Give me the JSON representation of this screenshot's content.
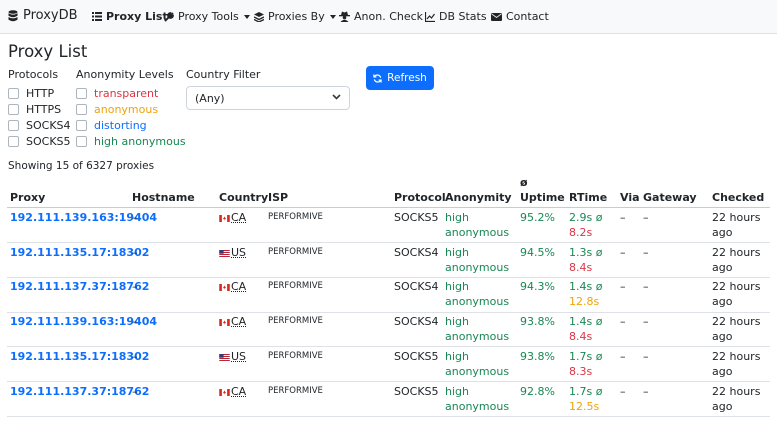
{
  "navbar": {
    "brand": "ProxyDB",
    "items": [
      {
        "label": "Proxy List",
        "icon": "list-icon",
        "bold": true
      },
      {
        "label": "Proxy Tools",
        "icon": "wrench-icon",
        "dropdown": true
      },
      {
        "label": "Proxies By",
        "icon": "layers-icon",
        "dropdown": true
      },
      {
        "label": "Anon. Check",
        "icon": "spy-icon"
      },
      {
        "label": "DB Stats",
        "icon": "chart-icon"
      },
      {
        "label": "Contact",
        "icon": "envelope-icon"
      }
    ]
  },
  "page": {
    "title": "Proxy List",
    "showing": "Showing 15 of 6327 proxies"
  },
  "filters": {
    "protocols_title": "Protocols",
    "protocols": [
      "HTTP",
      "HTTPS",
      "SOCKS4",
      "SOCKS5"
    ],
    "anonymity_title": "Anonymity Levels",
    "anonymity": [
      {
        "label": "transparent",
        "color": "#dc3545"
      },
      {
        "label": "anonymous",
        "color": "#f0a30a"
      },
      {
        "label": "distorting",
        "color": "#0d6efd"
      },
      {
        "label": "high anonymous",
        "color": "#198754"
      }
    ],
    "country_title": "Country Filter",
    "country_value": "(Any)",
    "refresh_label": "Refresh"
  },
  "table": {
    "headers": {
      "proxy": "Proxy",
      "hostname": "Hostname",
      "country": "Country",
      "isp": "ISP",
      "protocol": "Protocol",
      "anonymity": "Anonymity",
      "uptime_symbol": "ø",
      "uptime": "Uptime",
      "rtime": "RTime",
      "via": "Via",
      "gateway": "Gateway",
      "checked": "Checked"
    },
    "rows": [
      {
        "proxy": "192.111.139.163:19404",
        "hostname": "–",
        "country": "CA",
        "isp": "PERFORMIVE",
        "protocol": "SOCKS5",
        "anon1": "high",
        "anon2": "anonymous",
        "uptime": "95.2%",
        "rtime": "2.9s ø",
        "rtime2": "8.2s",
        "rtime2_color": "red",
        "via": "–",
        "gateway": "–",
        "checked1": "22 hours",
        "checked2": "ago"
      },
      {
        "proxy": "192.111.135.17:18302",
        "hostname": "–",
        "country": "US",
        "isp": "PERFORMIVE",
        "protocol": "SOCKS4",
        "anon1": "high",
        "anon2": "anonymous",
        "uptime": "94.5%",
        "rtime": "1.3s ø",
        "rtime2": "8.4s",
        "rtime2_color": "red",
        "via": "–",
        "gateway": "–",
        "checked1": "22 hours",
        "checked2": "ago"
      },
      {
        "proxy": "192.111.137.37:18762",
        "hostname": "–",
        "country": "CA",
        "isp": "PERFORMIVE",
        "protocol": "SOCKS4",
        "anon1": "high",
        "anon2": "anonymous",
        "uptime": "94.3%",
        "rtime": "1.4s ø",
        "rtime2": "12.8s",
        "rtime2_color": "orange",
        "via": "–",
        "gateway": "–",
        "checked1": "22 hours",
        "checked2": "ago"
      },
      {
        "proxy": "192.111.139.163:19404",
        "hostname": "–",
        "country": "CA",
        "isp": "PERFORMIVE",
        "protocol": "SOCKS4",
        "anon1": "high",
        "anon2": "anonymous",
        "uptime": "93.8%",
        "rtime": "1.4s ø",
        "rtime2": "8.4s",
        "rtime2_color": "red",
        "via": "–",
        "gateway": "–",
        "checked1": "22 hours",
        "checked2": "ago"
      },
      {
        "proxy": "192.111.135.17:18302",
        "hostname": "–",
        "country": "US",
        "isp": "PERFORMIVE",
        "protocol": "SOCKS5",
        "anon1": "high",
        "anon2": "anonymous",
        "uptime": "93.8%",
        "rtime": "1.7s ø",
        "rtime2": "8.3s",
        "rtime2_color": "red",
        "via": "–",
        "gateway": "–",
        "checked1": "22 hours",
        "checked2": "ago"
      },
      {
        "proxy": "192.111.137.37:18762",
        "hostname": "–",
        "country": "CA",
        "isp": "PERFORMIVE",
        "protocol": "SOCKS5",
        "anon1": "high",
        "anon2": "anonymous",
        "uptime": "92.8%",
        "rtime": "1.7s ø",
        "rtime2": "12.5s",
        "rtime2_color": "orange",
        "via": "–",
        "gateway": "–",
        "checked1": "22 hours",
        "checked2": "ago"
      }
    ]
  }
}
